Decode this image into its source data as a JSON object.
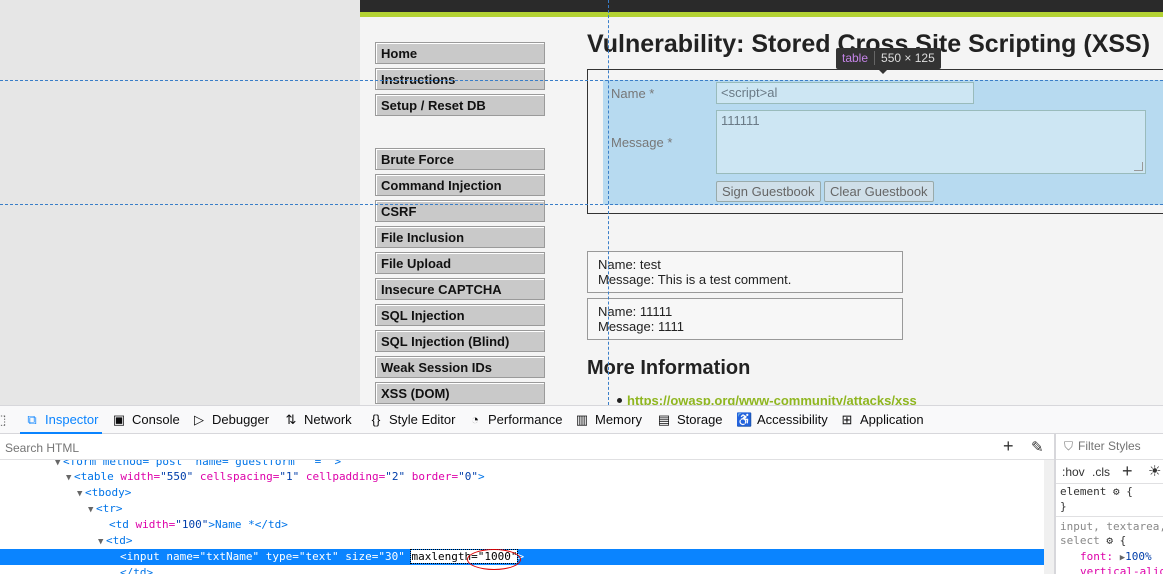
{
  "page": {
    "heading": "Vulnerability: Stored Cross Site Scripting (XSS)",
    "menu_group1": [
      "Home",
      "Instructions",
      "Setup / Reset DB"
    ],
    "menu_group2": [
      "Brute Force",
      "Command Injection",
      "CSRF",
      "File Inclusion",
      "File Upload",
      "Insecure CAPTCHA",
      "SQL Injection",
      "SQL Injection (Blind)",
      "Weak Session IDs",
      "XSS (DOM)"
    ],
    "form": {
      "name_label": "Name *",
      "name_value": "<script>al",
      "message_label": "Message *",
      "message_value": "111111",
      "sign_button": "Sign Guestbook",
      "clear_button": "Clear Guestbook"
    },
    "tooltip": {
      "tag": "table",
      "dims": "550 × 125"
    },
    "comments": [
      {
        "name": "Name: test",
        "message": "Message: This is a test comment."
      },
      {
        "name": "Name: 11111",
        "message": "Message: 1111"
      }
    ],
    "more_info": "More Information",
    "link": "https://owasp.org/www-community/attacks/xss"
  },
  "devtools": {
    "tabs": [
      {
        "label": "Inspector",
        "icon": "inspector-icon",
        "active": true
      },
      {
        "label": "Console",
        "icon": "console-icon"
      },
      {
        "label": "Debugger",
        "icon": "debugger-icon"
      },
      {
        "label": "Network",
        "icon": "network-icon"
      },
      {
        "label": "Style Editor",
        "icon": "style-editor-icon"
      },
      {
        "label": "Performance",
        "icon": "performance-icon"
      },
      {
        "label": "Memory",
        "icon": "memory-icon"
      },
      {
        "label": "Storage",
        "icon": "storage-icon"
      },
      {
        "label": "Accessibility",
        "icon": "accessibility-icon"
      },
      {
        "label": "Application",
        "icon": "application-icon"
      }
    ],
    "search_placeholder": "Search HTML",
    "html_lines": {
      "l0": "<form method=\"post\" name=\"guestform\" \"=\"\">",
      "l1_tag": "<table",
      "l1_a1": " width=",
      "l1_v1": "\"550\"",
      "l1_a2": " cellspacing=",
      "l1_v2": "\"1\"",
      "l1_a3": " cellpadding=",
      "l1_v3": "\"2\"",
      "l1_a4": " border=",
      "l1_v4": "\"0\"",
      "l1_end": ">",
      "l2": "<tbody>",
      "l3": "<tr>",
      "l4_open": "<td",
      "l4_attr": " width=",
      "l4_val": "\"100\"",
      "l4_text": ">Name *</td>",
      "l5": "<td>",
      "l6_tag": "<input",
      "l6_a1": " name=",
      "l6_v1": "\"txtName\"",
      "l6_a2": " type=",
      "l6_v2": "\"text\"",
      "l6_a3": " size=",
      "l6_v3": "\"30\"",
      "l6_a4": "maxlength=",
      "l6_v4": "\"1000\"",
      "l6_end": ">",
      "l7": "</td>"
    },
    "styles": {
      "filter_placeholder": "Filter Styles",
      "hov": ":hov",
      "cls": ".cls",
      "rule1_selector": "element",
      "rule1_open": "{",
      "rule1_close": "}",
      "rule2_selector": "input, textarea,",
      "rule2_selector2": "select",
      "rule2_open": "{",
      "prop1": "font:",
      "val1": "100%",
      "prop2": "vertical-alig"
    }
  }
}
